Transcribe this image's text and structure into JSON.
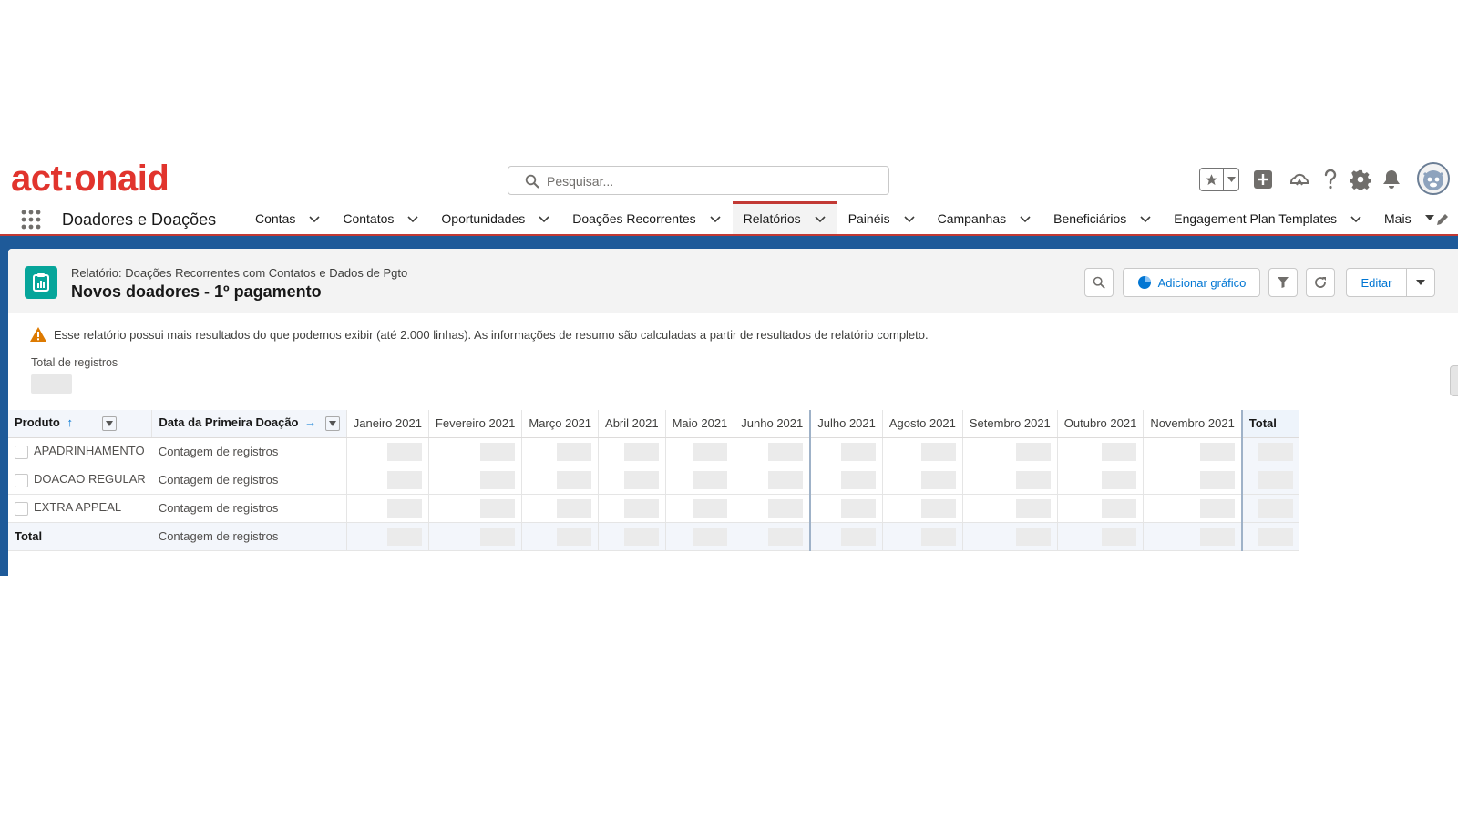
{
  "brand": {
    "logo_text": "act:onaid",
    "color": "#e1342d"
  },
  "search": {
    "placeholder": "Pesquisar..."
  },
  "header_icons": [
    "star-icon",
    "add-icon",
    "trailhead-icon",
    "help-icon",
    "gear-icon",
    "bell-icon",
    "avatar"
  ],
  "app": {
    "name": "Doadores e Doações"
  },
  "nav": {
    "items": [
      {
        "label": "Contas"
      },
      {
        "label": "Contatos"
      },
      {
        "label": "Oportunidades"
      },
      {
        "label": "Doações Recorrentes"
      },
      {
        "label": "Relatórios",
        "active": true
      },
      {
        "label": "Painéis"
      },
      {
        "label": "Campanhas"
      },
      {
        "label": "Beneficiários"
      },
      {
        "label": "Engagement Plan Templates"
      },
      {
        "label": "Mais"
      }
    ]
  },
  "report": {
    "type_label": "Relatório: Doações Recorrentes com Contatos e Dados de Pgto",
    "title": "Novos doadores - 1º pagamento",
    "add_chart_label": "Adicionar gráfico",
    "edit_label": "Editar",
    "warning": "Esse relatório possui mais resultados do que podemos exibir (até 2.000 linhas). As informações de resumo são calculadas a partir de resultados de relatório completo.",
    "total_records_label": "Total de registros"
  },
  "matrix": {
    "row_group_header": "Produto",
    "col_group_header": "Data da Primeira Doação",
    "columns": [
      "Janeiro 2021",
      "Fevereiro 2021",
      "Março 2021",
      "Abril 2021",
      "Maio 2021",
      "Junho 2021",
      "Julho 2021",
      "Agosto 2021",
      "Setembro 2021",
      "Outubro 2021",
      "Novembro 2021"
    ],
    "total_header": "Total",
    "rows": [
      {
        "product": "APADRINHAMENTO",
        "measure": "Contagem de registros"
      },
      {
        "product": "DOACAO REGULAR",
        "measure": "Contagem de registros"
      },
      {
        "product": "EXTRA APPEAL",
        "measure": "Contagem de registros"
      }
    ],
    "total_row": {
      "label": "Total",
      "measure": "Contagem de registros"
    }
  }
}
